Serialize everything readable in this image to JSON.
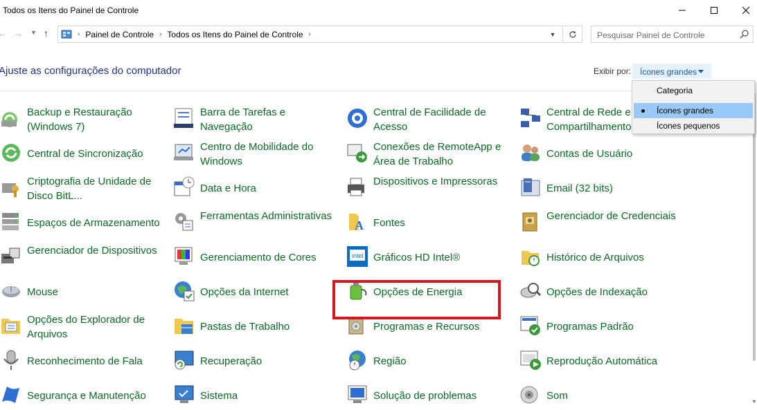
{
  "window": {
    "title": "Todos os Itens do Painel de Controle"
  },
  "nav": {
    "breadcrumbs": [
      "Painel de Controle",
      "Todos os Itens do Painel de Controle"
    ],
    "search_placeholder": "Pesquisar Painel de Controle"
  },
  "header": {
    "title": "Ajuste as configurações do computador",
    "view_by_label": "Exibir por:",
    "view_by_value": "Ícones grandes"
  },
  "view_menu": {
    "options": [
      "Categoria",
      "Ícones grandes",
      "Ícones pequenos"
    ],
    "selected": "Ícones grandes"
  },
  "highlight_color": "#d7171e",
  "link_color": "#0b6a23",
  "items": [
    {
      "label": "Backup e Restauração (Windows 7)",
      "icon": "backup-icon"
    },
    {
      "label": "Barra de Tarefas e Navegação",
      "icon": "taskbar-icon"
    },
    {
      "label": "Central de Facilidade de Acesso",
      "icon": "ease-of-access-icon"
    },
    {
      "label": "Central de Rede e Compartilhamento",
      "icon": "network-icon"
    },
    {
      "label": "Central de Sincronização",
      "icon": "sync-icon"
    },
    {
      "label": "Centro de Mobilidade do Windows",
      "icon": "mobility-icon"
    },
    {
      "label": "Conexões de RemoteApp e Área de Trabalho",
      "icon": "remoteapp-icon"
    },
    {
      "label": "Contas de Usuário",
      "icon": "user-accounts-icon"
    },
    {
      "label": "Criptografia de Unidade de Disco BitL...",
      "icon": "bitlocker-icon"
    },
    {
      "label": "Data e Hora",
      "icon": "date-time-icon"
    },
    {
      "label": "Dispositivos e Impressoras",
      "icon": "printer-icon"
    },
    {
      "label": "Email (32 bits)",
      "icon": "mail-icon"
    },
    {
      "label": "Espaços de Armazenamento",
      "icon": "storage-icon"
    },
    {
      "label": "Ferramentas Administrativas",
      "icon": "admin-tools-icon"
    },
    {
      "label": "Fontes",
      "icon": "fonts-icon"
    },
    {
      "label": "Gerenciador de Credenciais",
      "icon": "credentials-icon"
    },
    {
      "label": "Gerenciador de Dispositivos",
      "icon": "device-manager-icon"
    },
    {
      "label": "Gerenciamento de Cores",
      "icon": "color-management-icon"
    },
    {
      "label": "Gráficos HD Intel®",
      "icon": "intel-graphics-icon"
    },
    {
      "label": "Histórico de Arquivos",
      "icon": "file-history-icon"
    },
    {
      "label": "Mouse",
      "icon": "mouse-icon"
    },
    {
      "label": "Opções da Internet",
      "icon": "internet-options-icon"
    },
    {
      "label": "Opções de Energia",
      "icon": "power-options-icon"
    },
    {
      "label": "Opções de Indexação",
      "icon": "indexing-icon"
    },
    {
      "label": "Opções do Explorador de Arquivos",
      "icon": "folder-options-icon"
    },
    {
      "label": "Pastas de Trabalho",
      "icon": "work-folders-icon"
    },
    {
      "label": "Programas e Recursos",
      "icon": "programs-icon"
    },
    {
      "label": "Programas Padrão",
      "icon": "default-programs-icon"
    },
    {
      "label": "Reconhecimento de Fala",
      "icon": "microphone-icon"
    },
    {
      "label": "Recuperação",
      "icon": "recovery-icon"
    },
    {
      "label": "Região",
      "icon": "region-icon"
    },
    {
      "label": "Reprodução Automática",
      "icon": "autoplay-icon"
    },
    {
      "label": "Segurança e Manutenção",
      "icon": "security-flag-icon"
    },
    {
      "label": "Sistema",
      "icon": "system-icon"
    },
    {
      "label": "Solução de problemas",
      "icon": "troubleshooting-icon"
    },
    {
      "label": "Som",
      "icon": "sound-icon"
    }
  ]
}
